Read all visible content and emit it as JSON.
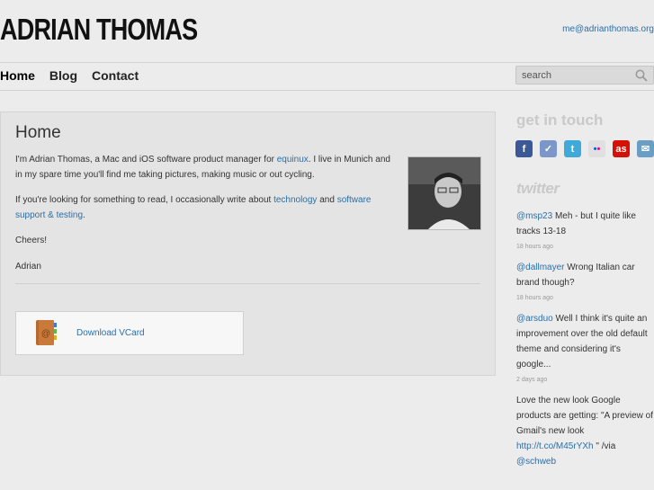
{
  "header": {
    "site_title": "ADRIAN THOMAS",
    "email": "me@adrianthomas.org"
  },
  "nav": {
    "items": [
      {
        "label": "Home"
      },
      {
        "label": "Blog"
      },
      {
        "label": "Contact"
      }
    ]
  },
  "search": {
    "placeholder": "search",
    "icon": "magnifier-icon"
  },
  "main": {
    "title": "Home",
    "p1_a": "I'm Adrian Thomas, a Mac and iOS software product manager for ",
    "p1_link": "equinux",
    "p1_b": ". I live in Munich and in my spare time you'll find me taking pictures, making music or out cycling.",
    "p2_a": "If you're looking for something to read, I occasionally write about ",
    "p2_link1": "technology",
    "p2_mid": " and ",
    "p2_link2": "software support & testing",
    "p2_end": ".",
    "p3": "Cheers!",
    "p4": "Adrian",
    "vcard_label": "Download VCard"
  },
  "sidebar": {
    "get_in_touch": "get in touch",
    "social": [
      {
        "name": "facebook-icon",
        "glyph": "f",
        "color": "#3b5998"
      },
      {
        "name": "foursquare-icon",
        "glyph": "✓",
        "color": "#7b97c9"
      },
      {
        "name": "twitter-icon",
        "glyph": "t",
        "color": "#3fa9d9"
      },
      {
        "name": "flickr-icon",
        "glyph": "••",
        "color": "#e0e0e0"
      },
      {
        "name": "lastfm-icon",
        "glyph": "as",
        "color": "#d51007"
      },
      {
        "name": "mail-icon",
        "glyph": "✉",
        "color": "#6a9ec4"
      }
    ],
    "twitter_heading": "twitter",
    "tweets": [
      {
        "handle": "@msp23",
        "text": " Meh - but I quite like tracks 13-18",
        "when": "18 hours ago"
      },
      {
        "handle": "@dallmayer",
        "text": " Wrong Italian car brand though?",
        "when": "18 hours ago"
      },
      {
        "handle": "@arsduo",
        "text": " Well I think it's quite an improvement over the old default theme and considering it's google...",
        "when": "2 days ago"
      },
      {
        "pre": "Love the new look Google products are getting: \"A preview of Gmail's new look ",
        "link": "http://t.co/M45rYXh",
        "mid": " \" /via ",
        "handle": "@schweb"
      }
    ]
  }
}
